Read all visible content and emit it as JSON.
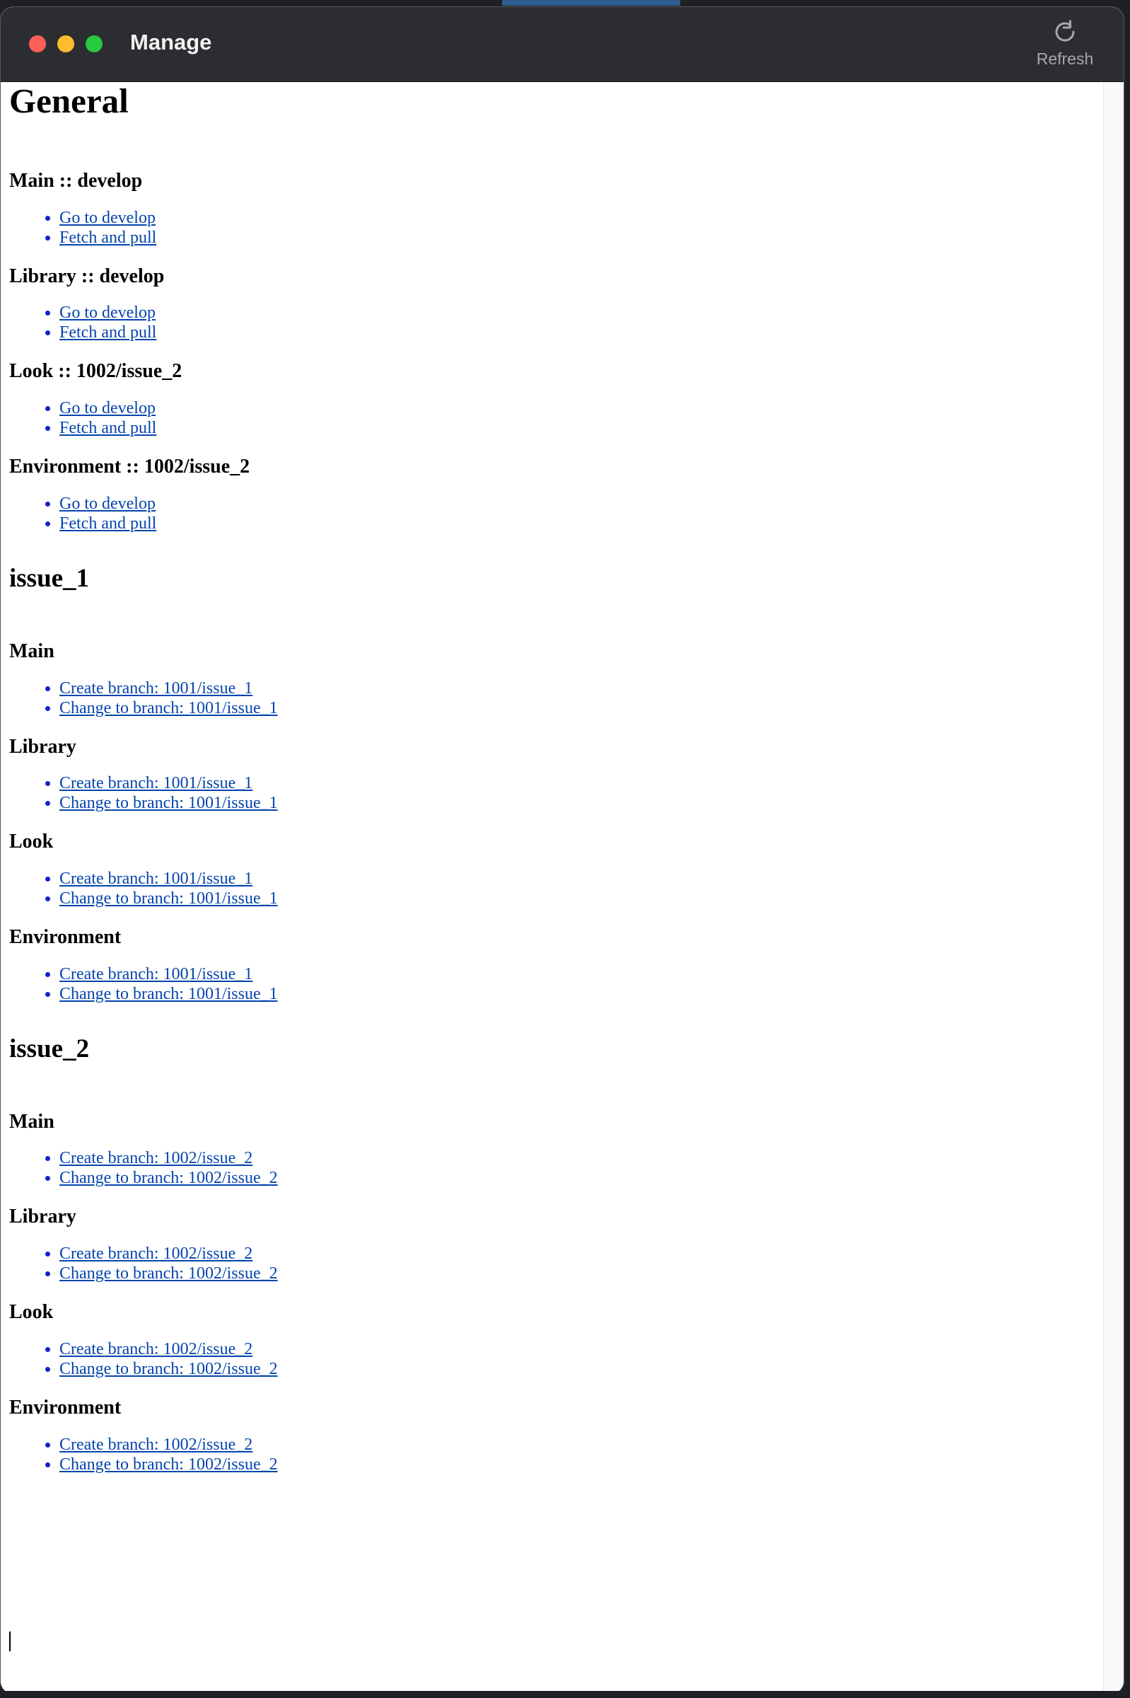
{
  "window": {
    "title": "Manage",
    "toolbar": {
      "refresh_label": "Refresh",
      "refresh_icon": "refresh-icon"
    }
  },
  "sections": [
    {
      "title": "General",
      "groups": [
        {
          "title": "Main :: develop",
          "actions": [
            "Go to develop",
            "Fetch and pull"
          ]
        },
        {
          "title": "Library :: develop",
          "actions": [
            "Go to develop",
            "Fetch and pull"
          ]
        },
        {
          "title": "Look :: 1002/issue_2",
          "actions": [
            "Go to develop",
            "Fetch and pull"
          ]
        },
        {
          "title": "Environment :: 1002/issue_2",
          "actions": [
            "Go to develop",
            "Fetch and pull"
          ]
        }
      ]
    },
    {
      "title": "issue_1",
      "groups": [
        {
          "title": "Main",
          "actions": [
            "Create branch: 1001/issue_1",
            "Change to branch: 1001/issue_1"
          ]
        },
        {
          "title": "Library",
          "actions": [
            "Create branch: 1001/issue_1",
            "Change to branch: 1001/issue_1"
          ]
        },
        {
          "title": "Look",
          "actions": [
            "Create branch: 1001/issue_1",
            "Change to branch: 1001/issue_1"
          ]
        },
        {
          "title": "Environment",
          "actions": [
            "Create branch: 1001/issue_1",
            "Change to branch: 1001/issue_1"
          ]
        }
      ]
    },
    {
      "title": "issue_2",
      "groups": [
        {
          "title": "Main",
          "actions": [
            "Create branch: 1002/issue_2",
            "Change to branch: 1002/issue_2"
          ]
        },
        {
          "title": "Library",
          "actions": [
            "Create branch: 1002/issue_2",
            "Change to branch: 1002/issue_2"
          ]
        },
        {
          "title": "Look",
          "actions": [
            "Create branch: 1002/issue_2",
            "Change to branch: 1002/issue_2"
          ]
        },
        {
          "title": "Environment",
          "actions": [
            "Create branch: 1002/issue_2",
            "Change to branch: 1002/issue_2"
          ]
        }
      ]
    }
  ],
  "colors": {
    "titlebar": "#2c2d31",
    "link": "#0645ad",
    "bullet": "#1621c7",
    "close": "#fe5f57",
    "minimize": "#febc2e",
    "maximize": "#28c840"
  }
}
